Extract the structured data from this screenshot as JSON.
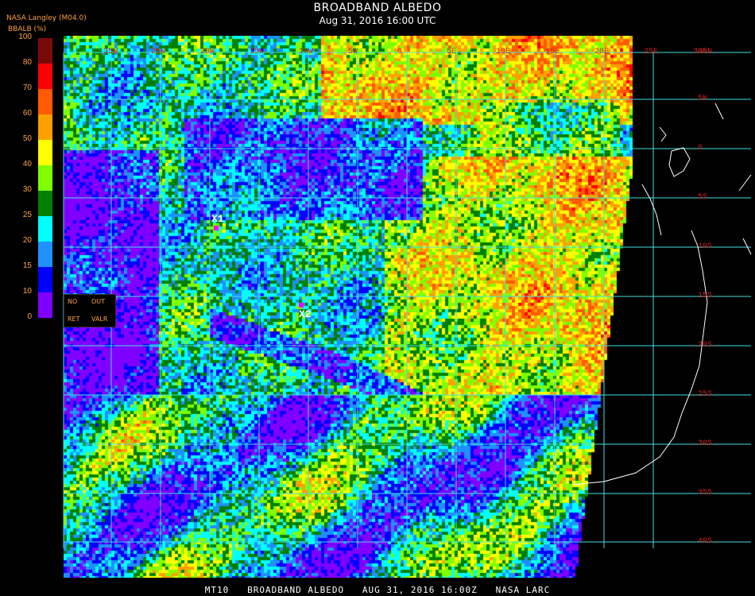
{
  "title": "BROADBAND ALBEDO",
  "subtitle": "Aug 31, 2016 16:00 UTC",
  "source": "NASA Langley (M04.0)",
  "legend": {
    "title": "BBALB (%)",
    "ticks": [
      "100",
      "80",
      "70",
      "60",
      "50",
      "40",
      "30",
      "25",
      "20",
      "15",
      "10",
      "0"
    ],
    "colors": [
      "#7a0a0a",
      "#ff0000",
      "#ff5a00",
      "#ffa000",
      "#ffff00",
      "#80ff00",
      "#008000",
      "#00ffff",
      "#1e90ff",
      "#0000ff",
      "#8000ff"
    ],
    "no_data": {
      "no": "NO",
      "out": "OUT",
      "ret": "RET",
      "valr": "VALR"
    }
  },
  "lat_labels": [
    "35N",
    "5N",
    "0",
    "5S",
    "10S",
    "15S",
    "20S",
    "25S",
    "30S",
    "35S",
    "40S"
  ],
  "lon_labels": [
    "35W",
    "25W",
    "20W",
    "15W",
    "10W",
    "5W",
    "0",
    "5E",
    "10E",
    "15E",
    "20E",
    "25E",
    "30E"
  ],
  "markers": [
    {
      "label": "X1",
      "color": "#ff00ff"
    },
    {
      "label": "X2",
      "color": "#ff00ff"
    }
  ],
  "footer": "MT10   BROADBAND ALBEDO   AUG 31, 2016 16:00Z   NASA LARC"
}
